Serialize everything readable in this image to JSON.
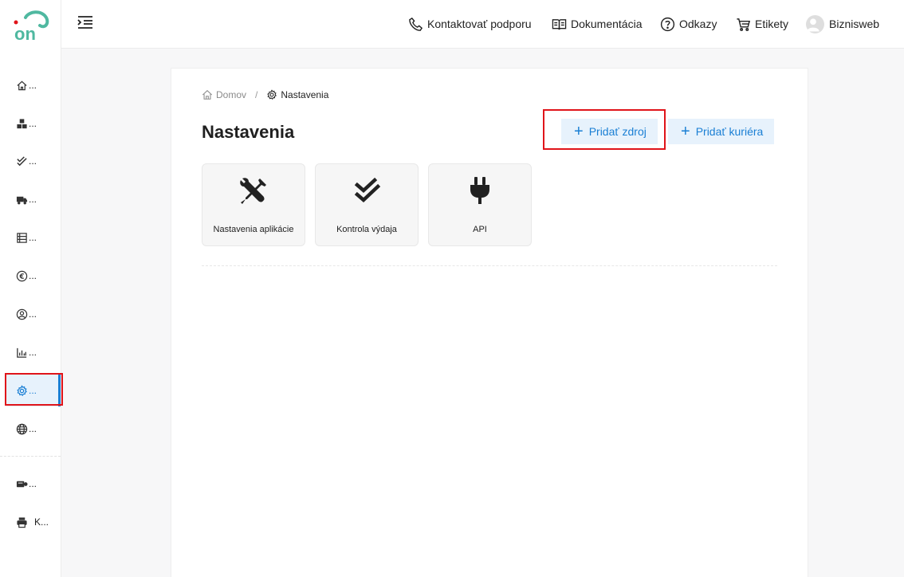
{
  "sidebar": {
    "items": [
      {
        "icon": "home-icon",
        "label": "..."
      },
      {
        "icon": "boxes-icon",
        "label": "..."
      },
      {
        "icon": "double-check-icon",
        "label": "..."
      },
      {
        "icon": "truck-icon",
        "label": "..."
      },
      {
        "icon": "list-icon",
        "label": "..."
      },
      {
        "icon": "euro-icon",
        "label": "..."
      },
      {
        "icon": "user-circle-icon",
        "label": "..."
      },
      {
        "icon": "bar-chart-icon",
        "label": "..."
      },
      {
        "icon": "gear-icon",
        "label": "...",
        "active": true
      },
      {
        "icon": "globe-icon",
        "label": "..."
      }
    ],
    "bottom_items": [
      {
        "icon": "shipping-label-icon",
        "label": "..."
      },
      {
        "icon": "printer-icon",
        "label": "K..."
      }
    ],
    "accent_color": "#1a7fd4"
  },
  "topbar": {
    "support": "Kontaktovať podporu",
    "docs": "Dokumentácia",
    "links": "Odkazy",
    "labels": "Etikety",
    "user": "Biznisweb"
  },
  "breadcrumb": {
    "home": "Domov",
    "separator": "/",
    "current": "Nastavenia"
  },
  "page": {
    "title": "Nastavenia",
    "add_source_button": "Pridať zdroj",
    "add_courier_button": "Pridať kuriéra"
  },
  "tiles": [
    {
      "icon": "tools-icon",
      "label": "Nastavenia aplikácie"
    },
    {
      "icon": "double-check-icon",
      "label": "Kontrola výdaja"
    },
    {
      "icon": "plug-icon",
      "label": "API"
    }
  ],
  "highlight_color": "#e0141a"
}
